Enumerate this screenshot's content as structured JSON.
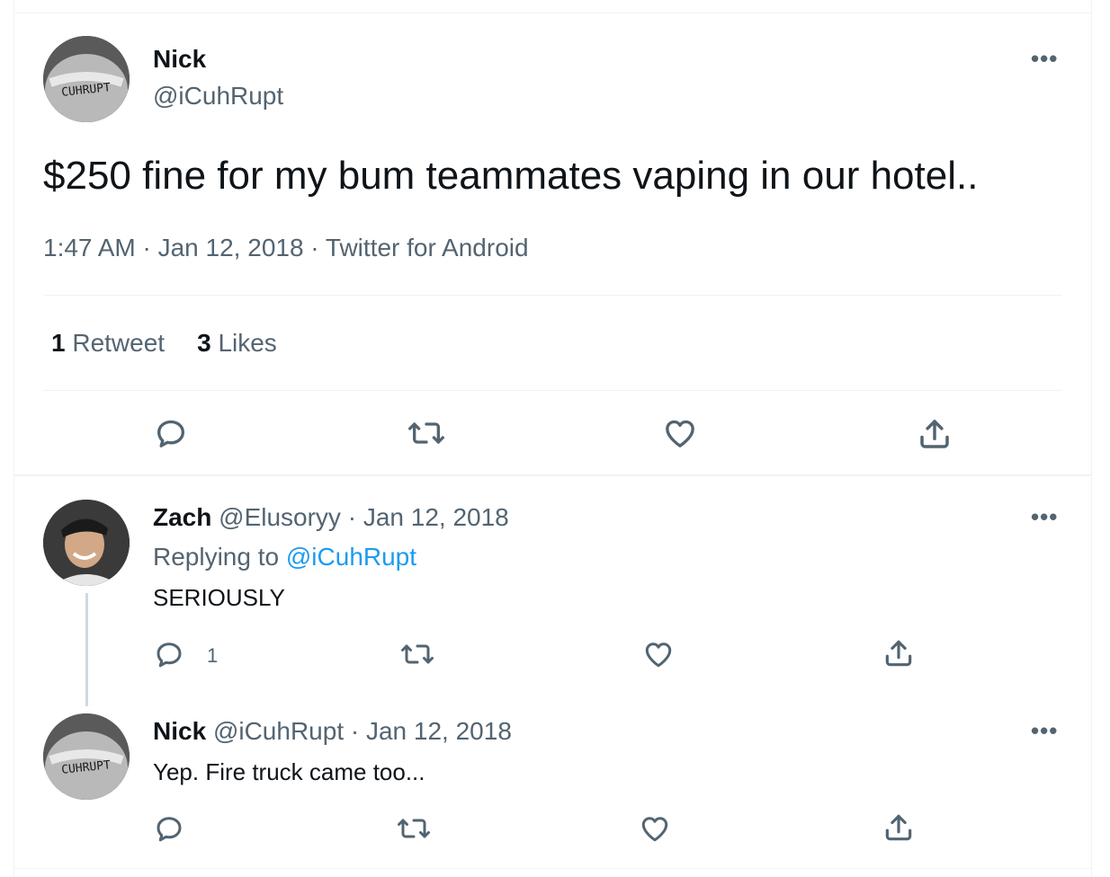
{
  "main_tweet": {
    "author_name": "Nick",
    "author_handle": "@iCuhRupt",
    "avatar_text": "CUHRUPT",
    "text": "$250 fine for my bum teammates vaping in our hotel..",
    "meta": "1:47 AM · Jan 12, 2018 · Twitter for Android",
    "retweet_count": "1",
    "retweet_label": "Retweet",
    "like_count": "3",
    "like_label": "Likes",
    "more_label": "•••"
  },
  "replies": [
    {
      "author_name": "Zach",
      "author_handle": "@Elusoryy",
      "separator": "·",
      "date": "Jan 12, 2018",
      "replying_to_label": "Replying to",
      "replying_to_handle": "@iCuhRupt",
      "text": "SERIOUSLY",
      "reply_count": "1",
      "more_label": "•••"
    },
    {
      "author_name": "Nick",
      "author_handle": "@iCuhRupt",
      "separator": "·",
      "date": "Jan 12, 2018",
      "avatar_text": "CUHRUPT",
      "text": "Yep. Fire truck came too...",
      "more_label": "•••"
    }
  ],
  "icons": [
    "reply-icon",
    "retweet-icon",
    "like-icon",
    "share-icon",
    "more-icon"
  ],
  "colors": {
    "accent": "#1d9bf0",
    "secondary_text": "#536471",
    "divider": "#eff3f4"
  }
}
